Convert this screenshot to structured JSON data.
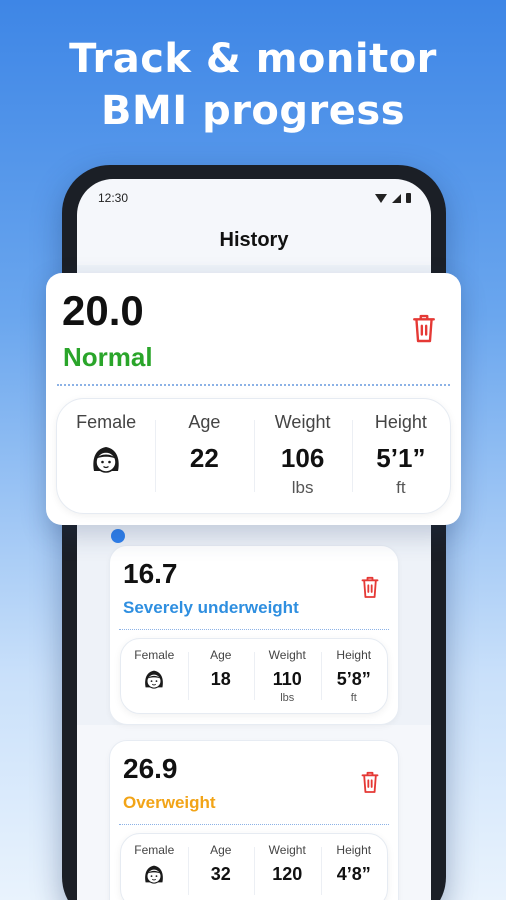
{
  "headline": {
    "line1": "Track & monitor",
    "line2": "BMI progress"
  },
  "status_bar": {
    "time": "12:30",
    "icons": [
      "wifi-icon",
      "signal-icon",
      "battery-icon"
    ]
  },
  "screen": {
    "title": "History"
  },
  "colors": {
    "normal": "#2aa52a",
    "underweight": "#2f8fe0",
    "overweight": "#f2a417",
    "delete": "#e53935",
    "accent": "#2f80ed"
  },
  "records": [
    {
      "bmi": "20.0",
      "category": "Normal",
      "gender": "Female",
      "age_label": "Age",
      "age": "22",
      "weight_label": "Weight",
      "weight": "106",
      "weight_unit": "lbs",
      "height_label": "Height",
      "height": "5’1”",
      "height_unit": "ft",
      "delete_icon": "trash-icon"
    },
    {
      "bmi": "16.7",
      "category": "Severely underweight",
      "gender": "Female",
      "age_label": "Age",
      "age": "18",
      "weight_label": "Weight",
      "weight": "110",
      "weight_unit": "lbs",
      "height_label": "Height",
      "height": "5’8”",
      "height_unit": "ft",
      "delete_icon": "trash-icon"
    },
    {
      "bmi": "26.9",
      "category": "Overweight",
      "gender": "Female",
      "age_label": "Age",
      "age": "32",
      "weight_label": "Weight",
      "weight": "120",
      "height_label": "Height",
      "height": "4’8”",
      "delete_icon": "trash-icon"
    }
  ]
}
